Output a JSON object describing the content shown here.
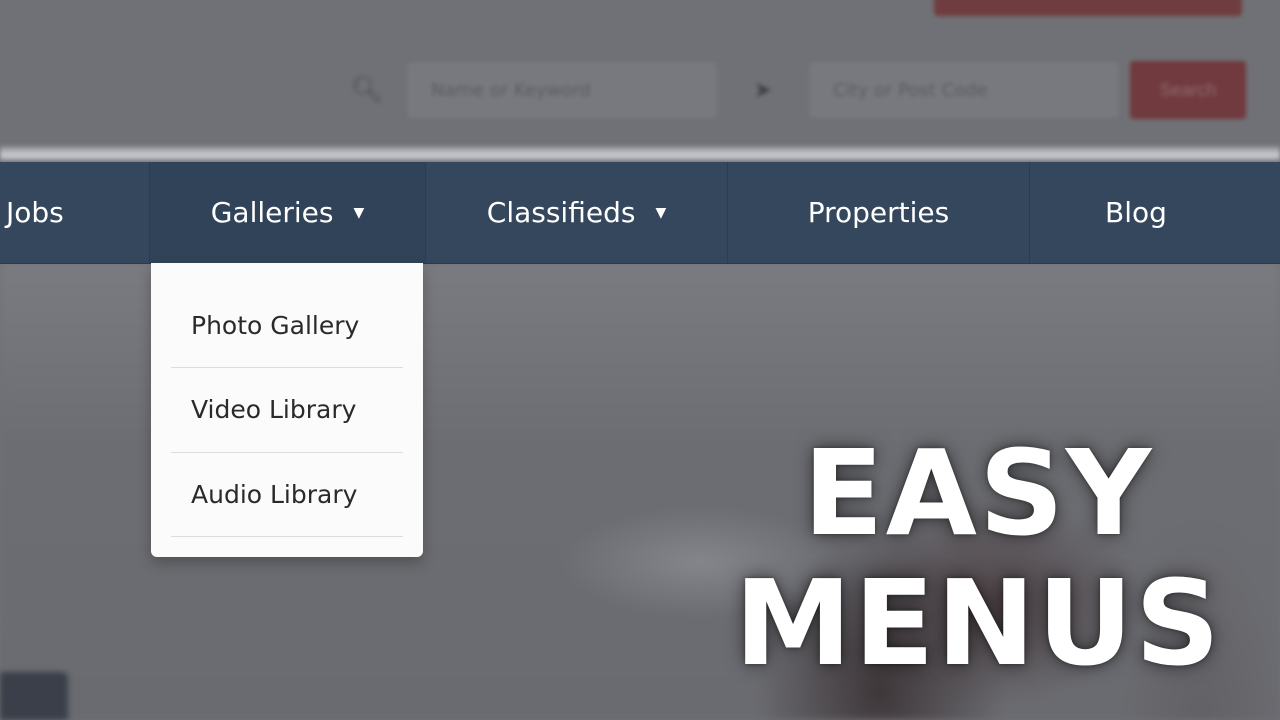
{
  "header": {
    "search": {
      "keyword_placeholder": "Name or Keyword",
      "location_placeholder": "City or Post Code",
      "search_button_label": "Search",
      "search_icon": "search-icon",
      "location_icon": "location-arrow-icon"
    }
  },
  "nav": {
    "items": [
      {
        "label": "Jobs",
        "has_dropdown": false
      },
      {
        "label": "Galleries",
        "has_dropdown": true,
        "active": true
      },
      {
        "label": "Classifieds",
        "has_dropdown": true
      },
      {
        "label": "Properties",
        "has_dropdown": false
      },
      {
        "label": "Blog",
        "has_dropdown": false
      }
    ],
    "caret_glyph": "▼",
    "colors": {
      "background": "#34475d",
      "text": "#ffffff"
    }
  },
  "dropdown": {
    "parent": "Galleries",
    "items": [
      {
        "label": "Photo Gallery"
      },
      {
        "label": "Video Library"
      },
      {
        "label": "Audio Library"
      }
    ]
  },
  "headline": {
    "line1": "EASY",
    "line2": "MENUS"
  },
  "colors": {
    "accent_red": "#703a3e",
    "dropdown_bg": "#fbfbfb"
  }
}
